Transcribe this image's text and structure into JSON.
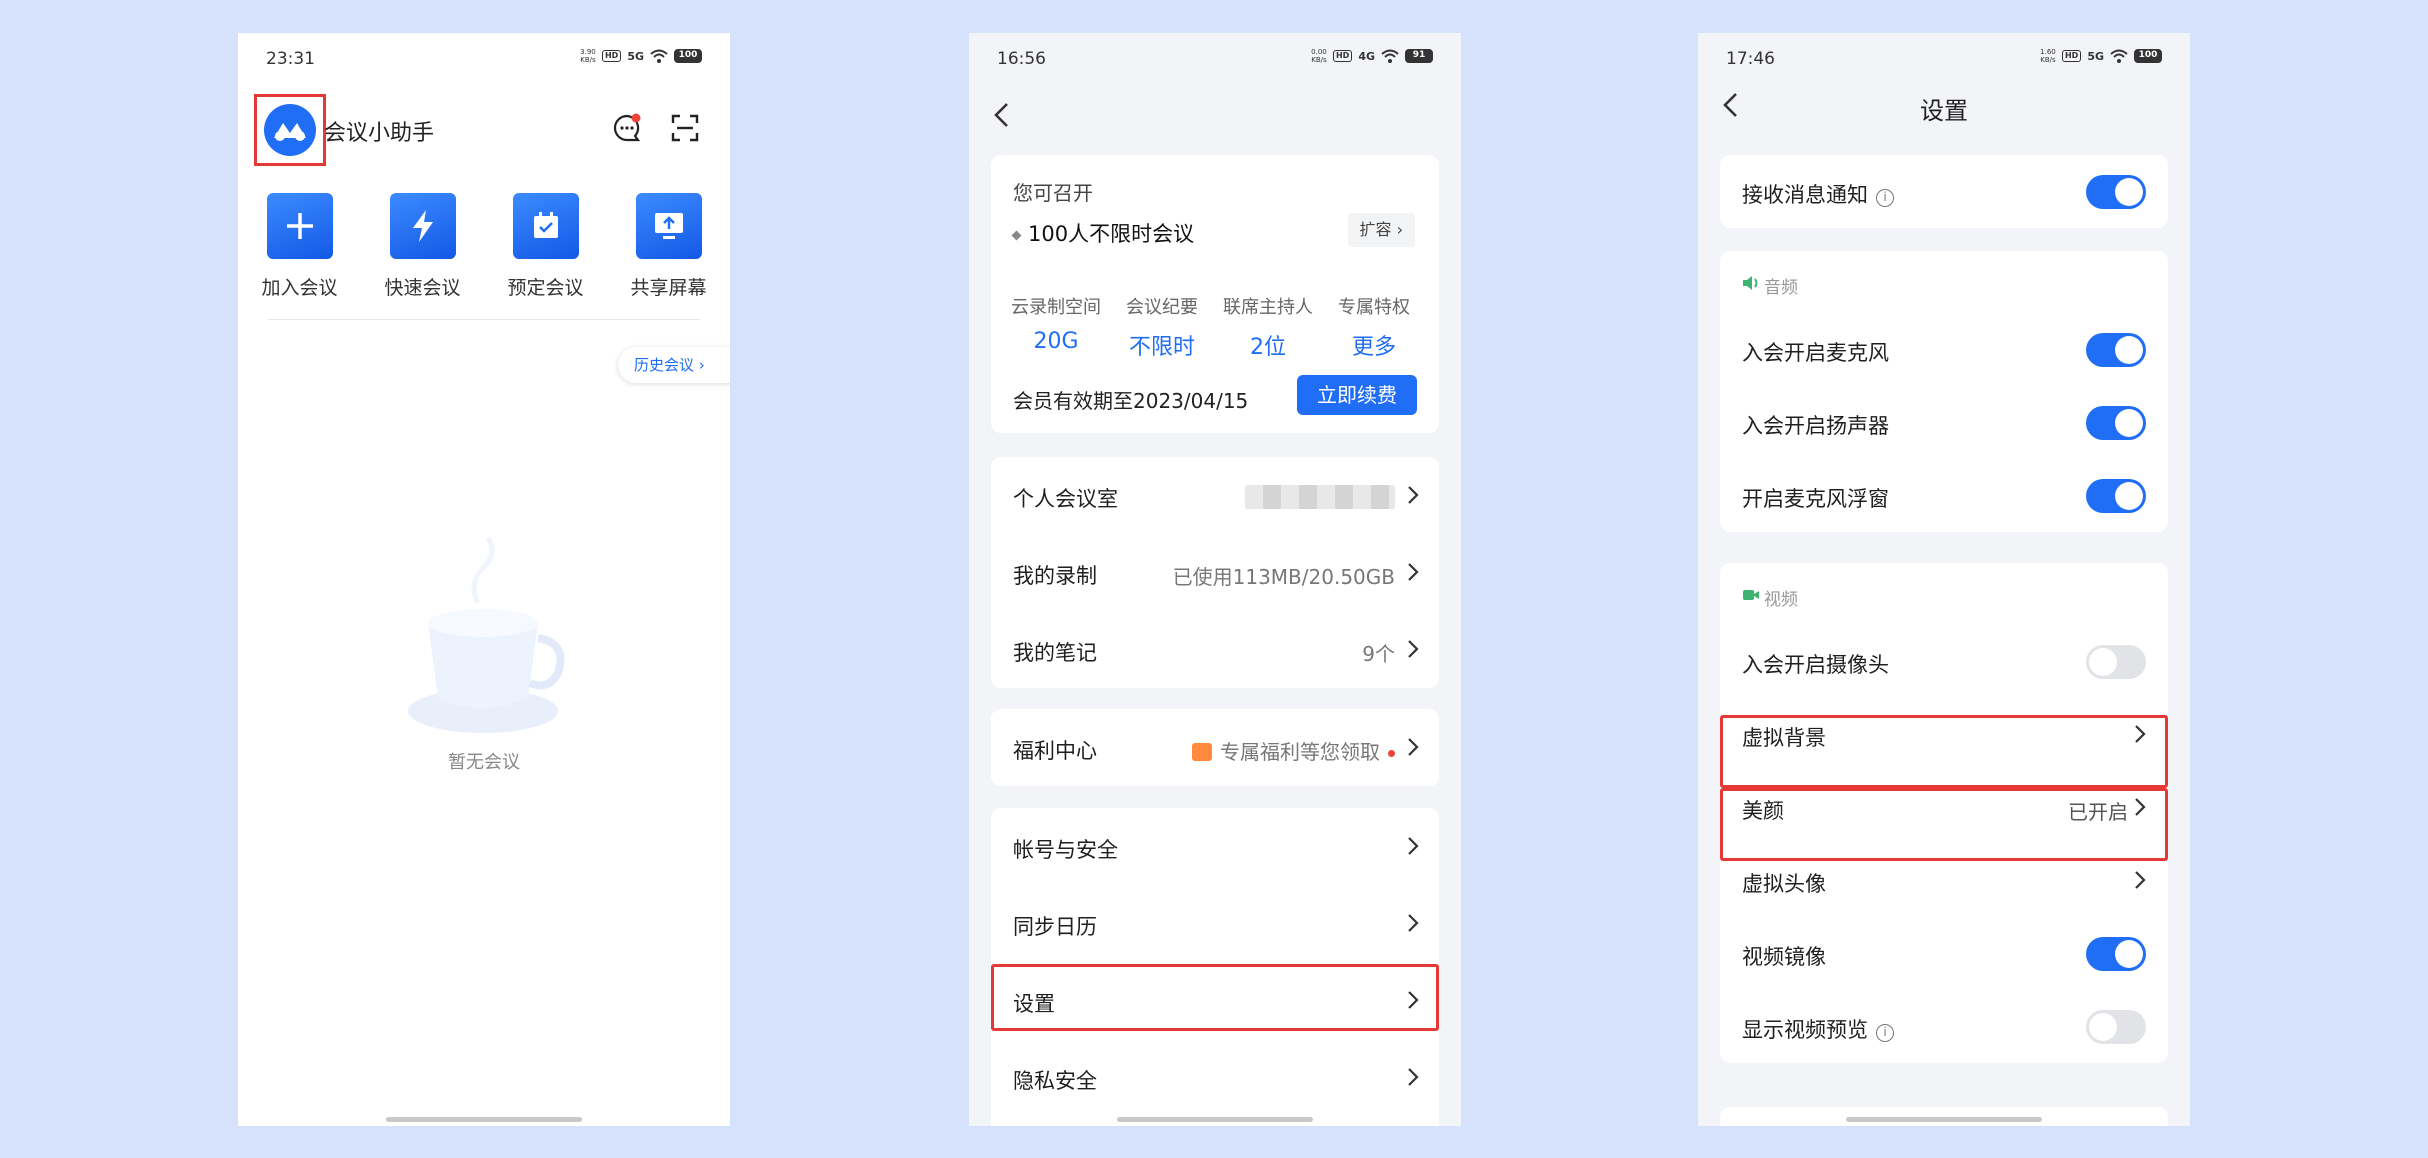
{
  "colors": {
    "accent": "#1f6ef5",
    "highlight": "#e53935",
    "page_bg": "#d6e2fb"
  },
  "screen1": {
    "status": {
      "time": "23:31",
      "net": "3.90 KB/s",
      "hd": "HD",
      "signal": "5G",
      "battery": "100"
    },
    "app_title": "会议小助手",
    "icons": [
      "logo-icon",
      "message-icon",
      "scan-icon"
    ],
    "actions": [
      {
        "label": "加入会议",
        "icon": "plus-icon"
      },
      {
        "label": "快速会议",
        "icon": "lightning-icon"
      },
      {
        "label": "预定会议",
        "icon": "calendar-icon"
      },
      {
        "label": "共享屏幕",
        "icon": "share-screen-icon"
      }
    ],
    "history_button": "历史会议",
    "empty_text": "暂无会议"
  },
  "screen2": {
    "status": {
      "time": "16:56",
      "net": "0.00 KB/s",
      "hd": "HD",
      "signal": "4G",
      "battery": "91"
    },
    "vip": {
      "title": "您可召开",
      "plan": "100人不限时会议",
      "expand": "扩容",
      "perks": [
        {
          "label": "云录制空间",
          "value": "20G"
        },
        {
          "label": "会议纪要",
          "value": "不限时"
        },
        {
          "label": "联席主持人",
          "value": "2位"
        },
        {
          "label": "专属特权",
          "value": "更多"
        }
      ],
      "expiry": "会员有效期至2023/04/15",
      "renew": "立即续费"
    },
    "group1": [
      {
        "label": "个人会议室",
        "value": ""
      },
      {
        "label": "我的录制",
        "value": "已使用113MB/20.50GB"
      },
      {
        "label": "我的笔记",
        "value": "9个"
      }
    ],
    "welfare": {
      "label": "福利中心",
      "value": "专属福利等您领取"
    },
    "group2": [
      {
        "label": "帐号与安全"
      },
      {
        "label": "同步日历"
      },
      {
        "label": "设置"
      },
      {
        "label": "隐私安全"
      }
    ]
  },
  "screen3": {
    "status": {
      "time": "17:46",
      "net": "1.60 KB/s",
      "hd": "HD",
      "signal": "5G",
      "battery": "100"
    },
    "title": "设置",
    "notify": {
      "label": "接收消息通知",
      "on": true
    },
    "audio": {
      "header": "音频",
      "items": [
        {
          "label": "入会开启麦克风",
          "on": true
        },
        {
          "label": "入会开启扬声器",
          "on": true
        },
        {
          "label": "开启麦克风浮窗",
          "on": true
        }
      ]
    },
    "video": {
      "header": "视频",
      "camera": {
        "label": "入会开启摄像头",
        "on": false
      },
      "virtual_bg": {
        "label": "虚拟背景"
      },
      "beauty": {
        "label": "美颜",
        "value": "已开启"
      },
      "avatar": {
        "label": "虚拟头像"
      },
      "mirror": {
        "label": "视频镜像",
        "on": true
      },
      "preview": {
        "label": "显示视频预览",
        "on": false
      }
    }
  }
}
